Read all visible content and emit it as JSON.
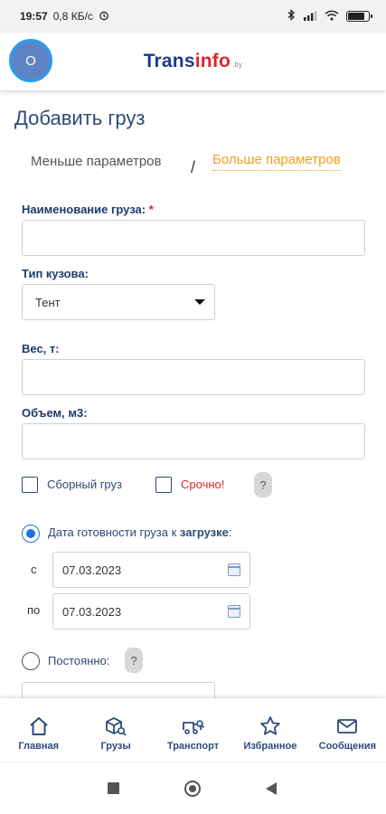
{
  "status_bar": {
    "time": "19:57",
    "network_speed": "0,8 КБ/с",
    "alarm_icon": "alarm-icon",
    "bluetooth_icon": "bluetooth-icon",
    "signal_icon": "signal-icon",
    "wifi_icon": "wifi-icon",
    "battery_level": 0.85
  },
  "header": {
    "avatar_initial": "О",
    "logo_main": "Trans",
    "logo_accent": "info",
    "logo_tld": ".by",
    "colors": {
      "brand": "#1d3a8a",
      "accent": "#d6282f"
    }
  },
  "page": {
    "title": "Добавить груз"
  },
  "mode_switch": {
    "less": "Меньше параметров",
    "separator": "/",
    "more": "Больше параметров",
    "active_color": "#f0a01c"
  },
  "form": {
    "cargo_name_label": "Наименование груза:",
    "required_mark": "*",
    "cargo_name_value": "",
    "body_type_label": "Тип кузова:",
    "body_type_value": "Тент",
    "weight_label": "Вес, т:",
    "weight_value": "",
    "volume_label": "Объем, м3:",
    "volume_value": "",
    "combined_cargo_label": "Сборный груз",
    "urgent_label": "Срочно!",
    "help_label": "?",
    "ready_date_label_prefix": "Дата готовности груза к ",
    "ready_date_label_bold": "загрузке",
    "ready_date_label_suffix": ":",
    "date_from_prefix": "с",
    "date_from": "07.03.2023",
    "date_to_prefix": "по",
    "date_to": "07.03.2023",
    "permanent_label": "Постоянно:",
    "urgent_color": "#d6282f",
    "selected_radio": "ready_date"
  },
  "bottom_nav": {
    "items": [
      {
        "label": "Главная",
        "icon": "home-icon"
      },
      {
        "label": "Грузы",
        "icon": "cargo-search-icon"
      },
      {
        "label": "Транспорт",
        "icon": "truck-search-icon"
      },
      {
        "label": "Избранное",
        "icon": "star-icon"
      },
      {
        "label": "Сообщения",
        "icon": "mail-icon"
      }
    ]
  },
  "system_nav": {
    "recents_icon": "square-icon",
    "home_icon": "circle-home-icon",
    "back_icon": "back-triangle-icon"
  }
}
